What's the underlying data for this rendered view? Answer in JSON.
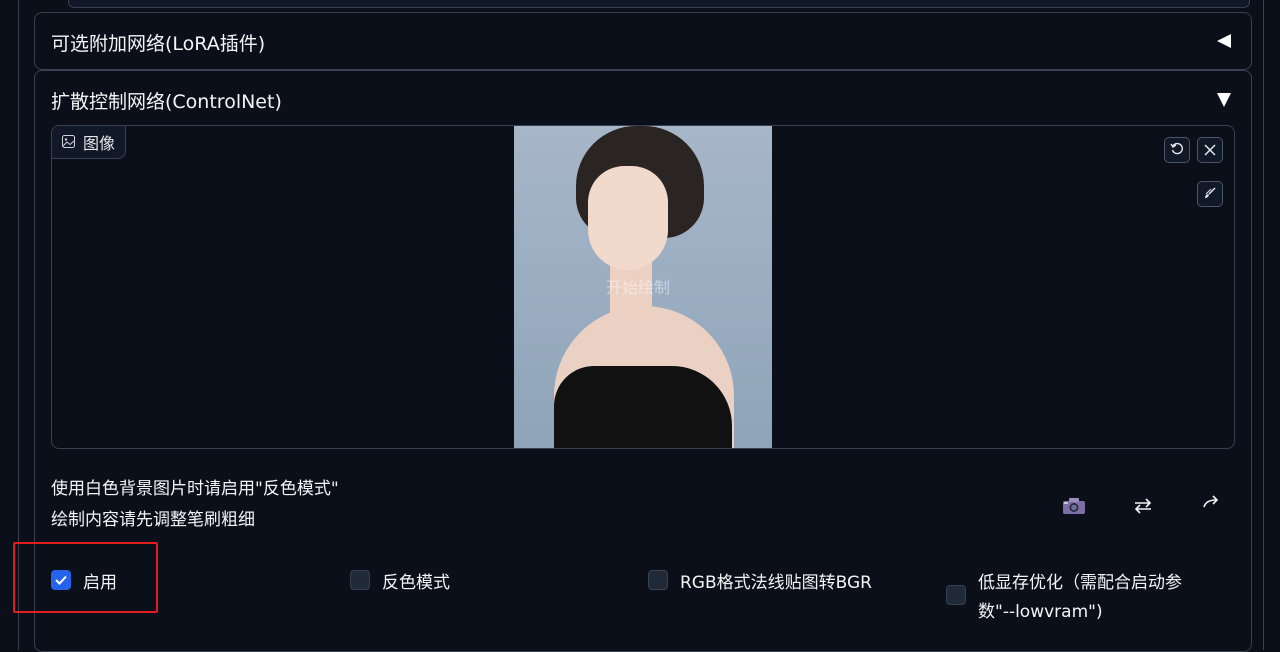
{
  "accordions": {
    "lora": {
      "title": "可选附加网络(LoRA插件)",
      "state": "collapsed"
    },
    "controlnet": {
      "title": "扩散控制网络(ControlNet)",
      "state": "expanded"
    }
  },
  "image_panel": {
    "label": "图像",
    "watermark": "开始绘制"
  },
  "hints": {
    "line1": "使用白色背景图片时请启用\"反色模式\"",
    "line2": "绘制内容请先调整笔刷粗细"
  },
  "checkboxes": [
    {
      "label": "启用",
      "checked": true
    },
    {
      "label": "反色模式",
      "checked": false
    },
    {
      "label": "RGB格式法线贴图转BGR",
      "checked": false
    },
    {
      "label_line1": "低显存优化（需配合启动参",
      "label_line2": "数\"--lowvram\")",
      "checked": false
    }
  ],
  "icons": {
    "image_tab": "image-icon",
    "undo": "undo-icon",
    "close": "close-icon",
    "brush": "brush-icon",
    "camera": "camera-icon",
    "swap": "swap-icon",
    "send": "send-icon"
  },
  "colors": {
    "background": "#0b0f19",
    "border": "#374151",
    "checkbox_checked": "#2563eb",
    "highlight": "#e11d1d"
  }
}
